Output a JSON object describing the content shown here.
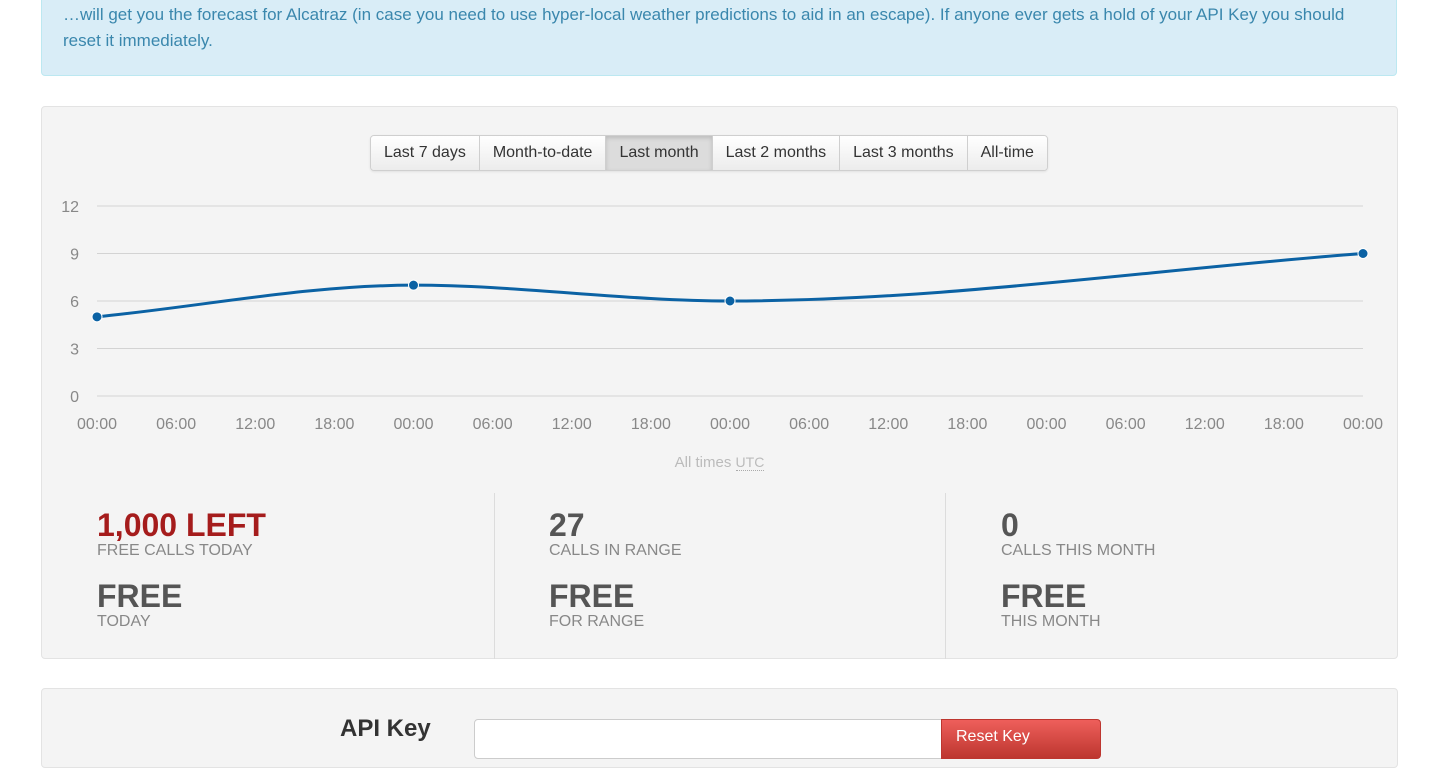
{
  "alert": {
    "text": "…will get you the forecast for Alcatraz (in case you need to use hyper-local weather predictions to aid in an escape). If anyone ever gets a hold of your API Key you should reset it immediately."
  },
  "range_buttons": [
    {
      "label": "Last 7 days",
      "active": false
    },
    {
      "label": "Month-to-date",
      "active": false
    },
    {
      "label": "Last month",
      "active": true
    },
    {
      "label": "Last 2 months",
      "active": false
    },
    {
      "label": "Last 3 months",
      "active": false
    },
    {
      "label": "All-time",
      "active": false
    }
  ],
  "chart_data": {
    "type": "line",
    "title": "",
    "xlabel": "",
    "ylabel": "",
    "x": [
      "00:00",
      "06:00",
      "12:00",
      "18:00",
      "00:00",
      "06:00",
      "12:00",
      "18:00",
      "00:00",
      "06:00",
      "12:00",
      "18:00",
      "00:00",
      "06:00",
      "12:00",
      "18:00",
      "00:00"
    ],
    "series": [
      {
        "points": [
          [
            0,
            5
          ],
          [
            4,
            7
          ],
          [
            8,
            6
          ],
          [
            16,
            9
          ]
        ]
      }
    ],
    "y_ticks": [
      0,
      3,
      6,
      9,
      12
    ],
    "ylim": [
      0,
      12
    ],
    "grid": true,
    "line_color": "#0b62a4"
  },
  "timezone_note": {
    "prefix": "All times",
    "tz": "UTC"
  },
  "stats": [
    {
      "value": "1,000 LEFT",
      "label": "FREE CALLS TODAY",
      "cost": "FREE",
      "cost_label": "TODAY"
    },
    {
      "value": "27",
      "label": "CALLS IN RANGE",
      "cost": "FREE",
      "cost_label": "FOR RANGE"
    },
    {
      "value": "0",
      "label": "CALLS THIS MONTH",
      "cost": "FREE",
      "cost_label": "THIS MONTH"
    }
  ],
  "api_key": {
    "label": "API Key",
    "value": "",
    "reset_label": "Reset Key"
  },
  "colors": {
    "accent_red": "#a51c1c",
    "alert_text": "#3a87ad",
    "line": "#0b62a4"
  }
}
